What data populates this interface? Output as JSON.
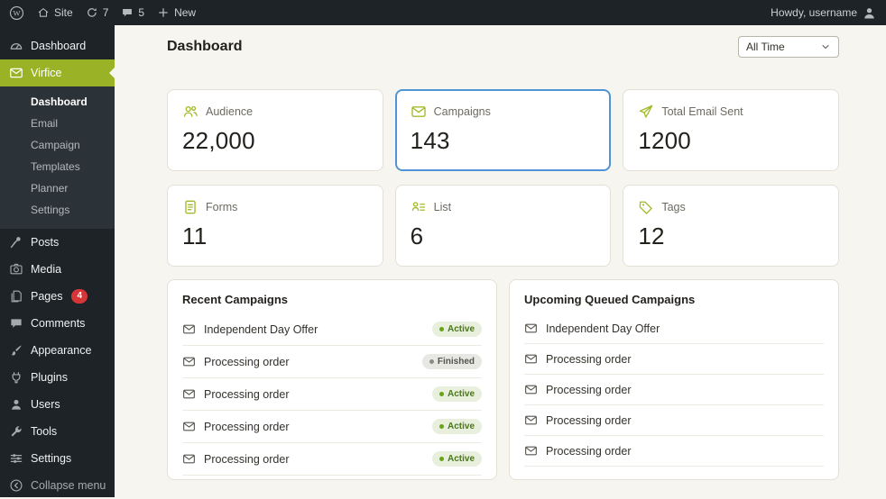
{
  "colors": {
    "admin_dark": "#1d2327",
    "submenu_dark": "#2c3338",
    "content_cream": "#f7f5f0",
    "brand_lime": "#9ab226",
    "icon_lime": "#a4ba2a",
    "selected_card_blue": "#4f94d4",
    "active_badge_green": "#67a416",
    "pages_badge_red": "#d63638"
  },
  "admin_bar": {
    "site": "Site",
    "updates_count": "7",
    "comments_count": "5",
    "new_label": "New",
    "howdy": "Howdy, username"
  },
  "sidebar": {
    "top_items": [
      {
        "label": "Dashboard",
        "icon": "dashboard-gauge-icon"
      },
      {
        "label": "Virfice",
        "icon": "envelope-icon",
        "active": true
      }
    ],
    "virfice_submenu": [
      {
        "label": "Dashboard",
        "current": true
      },
      {
        "label": "Email"
      },
      {
        "label": "Campaign"
      },
      {
        "label": "Templates"
      },
      {
        "label": "Planner"
      },
      {
        "label": "Settings"
      }
    ],
    "items": [
      {
        "label": "Posts",
        "icon": "pushpin-icon"
      },
      {
        "label": "Media",
        "icon": "camera-icon"
      },
      {
        "label": "Pages",
        "icon": "pages-icon",
        "badge": "4"
      },
      {
        "label": "Comments",
        "icon": "comment-icon"
      },
      {
        "label": "Appearance",
        "icon": "paintbrush-icon"
      },
      {
        "label": "Plugins",
        "icon": "plug-icon"
      },
      {
        "label": "Users",
        "icon": "person-icon"
      },
      {
        "label": "Tools",
        "icon": "wrench-icon"
      },
      {
        "label": "Settings",
        "icon": "sliders-icon"
      }
    ],
    "collapse": {
      "label": "Collapse menu",
      "icon": "collapse-arrow-icon"
    }
  },
  "main": {
    "title": "Dashboard",
    "time_filter": {
      "value": "All Time",
      "icon": "chevron-down-icon"
    },
    "stats": [
      {
        "label": "Audience",
        "value": "22,000",
        "icon": "audience-people-icon"
      },
      {
        "label": "Campaigns",
        "value": "143",
        "icon": "envelope-icon",
        "selected": true
      },
      {
        "label": "Total Email Sent",
        "value": "1200",
        "icon": "paper-plane-icon"
      },
      {
        "label": "Forms",
        "value": "11",
        "icon": "document-lines-icon"
      },
      {
        "label": "List",
        "value": "6",
        "icon": "person-list-icon"
      },
      {
        "label": "Tags",
        "value": "12",
        "icon": "tag-icon"
      }
    ],
    "recent_campaigns": {
      "title": "Recent Campaigns",
      "rows": [
        {
          "name": "Independent Day Offer",
          "status": "Active"
        },
        {
          "name": "Processing order",
          "status": "Finished"
        },
        {
          "name": "Processing order",
          "status": "Active"
        },
        {
          "name": "Processing order",
          "status": "Active"
        },
        {
          "name": "Processing order",
          "status": "Active"
        }
      ]
    },
    "upcoming_campaigns": {
      "title": "Upcoming Queued Campaigns",
      "rows": [
        {
          "name": "Independent Day Offer"
        },
        {
          "name": "Processing order"
        },
        {
          "name": "Processing order"
        },
        {
          "name": "Processing order"
        },
        {
          "name": "Processing order"
        }
      ]
    }
  }
}
